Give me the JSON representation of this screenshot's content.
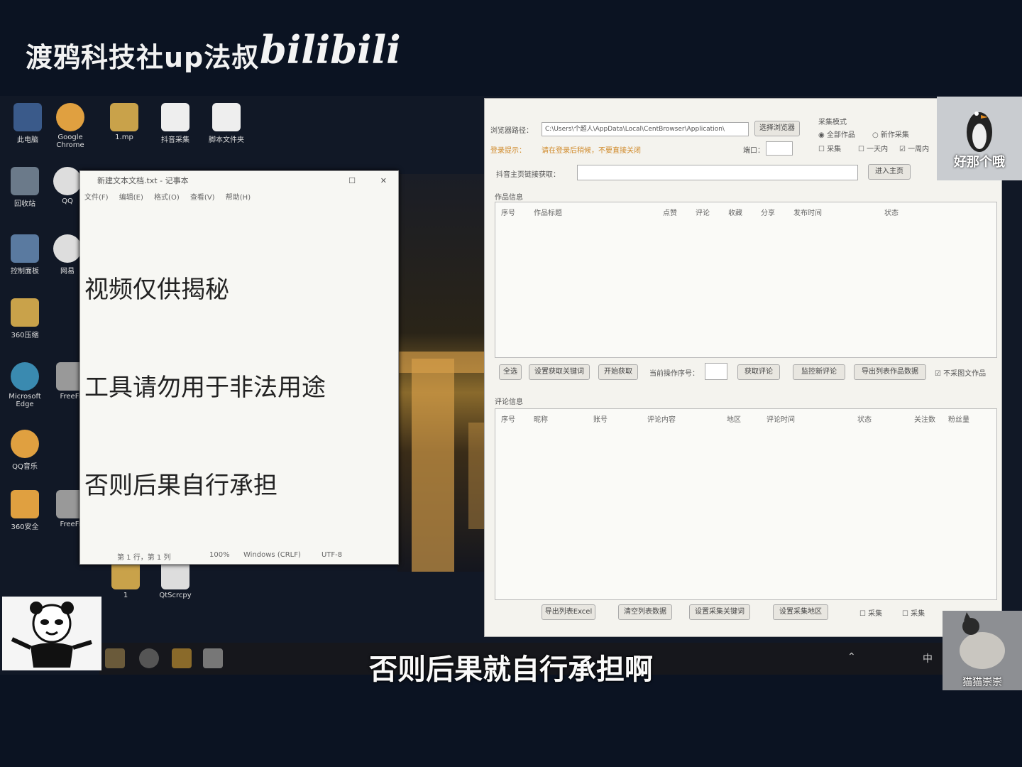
{
  "header": {
    "channel": "渡鸦科技社up法叔",
    "logo": "bilibili"
  },
  "desktop_icons": [
    {
      "label": "此电脑"
    },
    {
      "label": "Google Chrome"
    },
    {
      "label": "1.mp"
    },
    {
      "label": "抖音采集"
    },
    {
      "label": "脚本文件夹"
    },
    {
      "label": "回收站"
    },
    {
      "label": "QQ"
    },
    {
      "label": "控制面板"
    },
    {
      "label": "网易"
    },
    {
      "label": "360压缩"
    },
    {
      "label": "Microsoft Edge"
    },
    {
      "label": "FreeFi"
    },
    {
      "label": "QQ音乐"
    },
    {
      "label": "360安全"
    },
    {
      "label": "FreeFi"
    },
    {
      "label": "1"
    },
    {
      "label": "QtScrcpy"
    }
  ],
  "notepad": {
    "title": "新建文本文档.txt - 记事本",
    "menu": [
      "文件(F)",
      "编辑(E)",
      "格式(O)",
      "查看(V)",
      "帮助(H)"
    ],
    "lines": [
      "视频仅供揭秘",
      "工具请勿用于非法用途",
      "否则后果自行承担"
    ],
    "status": {
      "position": "第 1 行，第 1 列",
      "zoom": "100%",
      "eol": "Windows (CRLF)",
      "encoding": "UTF-8"
    }
  },
  "tool": {
    "browser_path_label": "浏览器路径：",
    "browser_path_value": "C:\\Users\\个超人\\AppData\\Local\\CentBrowser\\Application\\",
    "select_path_button": "选择浏览器",
    "hint_label": "登录提示：",
    "hint_text": "请在登录后稍候，不要直接关闭",
    "port_label": "端口：",
    "collect_mode_label": "采集模式",
    "radio_options": [
      "全部作品",
      "新作采集"
    ],
    "checkbox_options": [
      "采集",
      "一天内",
      "一周内"
    ],
    "homepage_label": "抖音主页链接获取：",
    "enter_homepage_button": "进入主页",
    "works_section": "作品信息",
    "works_columns": [
      "序号",
      "作品标题",
      "点赞",
      "评论",
      "收藏",
      "分享",
      "发布时间",
      "状态"
    ],
    "works_buttons": [
      "全选",
      "设置获取关键词",
      "开始获取",
      "当前操作序号：",
      "获取评论",
      "监控新评论",
      "导出列表作品数据"
    ],
    "skip_checkbox": "不采图文作品",
    "comments_section": "评论信息",
    "comments_columns": [
      "序号",
      "昵称",
      "账号",
      "评论内容",
      "地区",
      "评论时间",
      "状态",
      "关注数",
      "粉丝量"
    ],
    "comments_buttons": [
      "导出列表Excel",
      "清空列表数据",
      "设置采集关键词",
      "设置采集地区"
    ],
    "comments_checkboxes": [
      "采集",
      "采集"
    ]
  },
  "overlays": {
    "top_avatar_name": "好那个哦",
    "bottom_avatar_name": "猫猫崇崇"
  },
  "subtitle": "否则后果就自行承担啊",
  "taskbar": {
    "ime": "中"
  }
}
